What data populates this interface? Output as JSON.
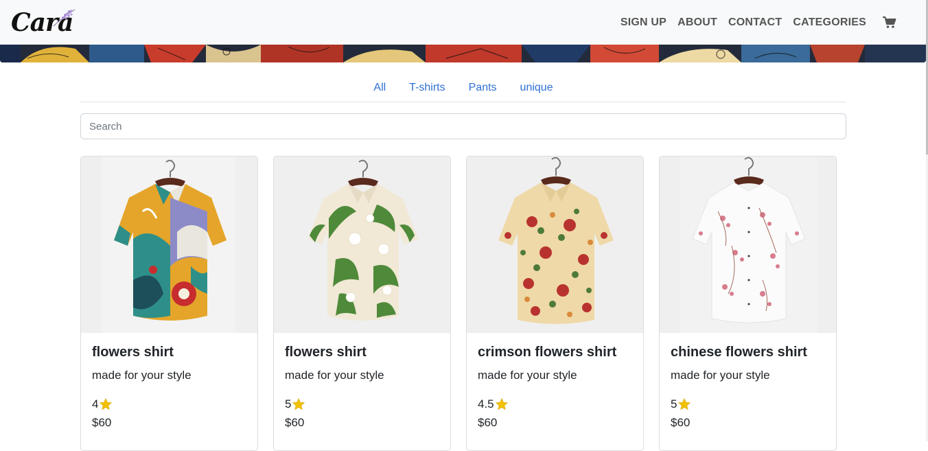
{
  "brand": {
    "name": "Cara",
    "icon": "lavender-sprig-icon"
  },
  "nav": {
    "links": [
      "SIGN UP",
      "ABOUT",
      "CONTACT",
      "CATEGORIES"
    ],
    "cart_icon": "shopping-cart-icon"
  },
  "filters": {
    "tabs": [
      "All",
      "T-shirts",
      "Pants",
      "unique"
    ]
  },
  "search": {
    "placeholder": "Search",
    "value": ""
  },
  "products": [
    {
      "title": "flowers shirt",
      "description": "made for your style",
      "rating": "4",
      "price": "$60",
      "image": "colorful-abstract-floral-shirt"
    },
    {
      "title": "flowers shirt",
      "description": "made for your style",
      "rating": "5",
      "price": "$60",
      "image": "green-leaf-floral-shirt"
    },
    {
      "title": "crimson flowers shirt",
      "description": "made for your style",
      "rating": "4.5",
      "price": "$60",
      "image": "crimson-floral-shirt"
    },
    {
      "title": "chinese flowers shirt",
      "description": "made for your style",
      "rating": "5",
      "price": "$60",
      "image": "white-pink-blossom-shirt"
    }
  ],
  "colors": {
    "navbar_bg": "#f8f9fa",
    "link_blue": "#2f6fd6",
    "star": "#f2c200"
  }
}
